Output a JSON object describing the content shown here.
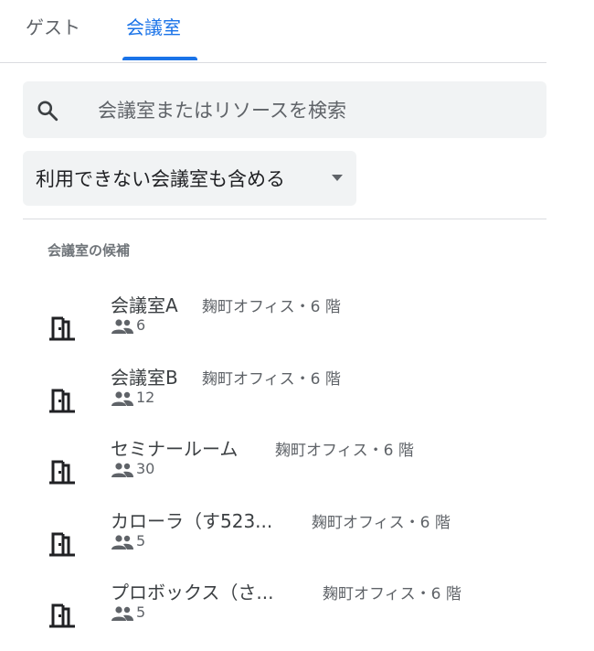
{
  "tabs": [
    {
      "label": "ゲスト",
      "active": false
    },
    {
      "label": "会議室",
      "active": true
    }
  ],
  "search": {
    "placeholder": "会議室またはリソースを検索",
    "value": ""
  },
  "filter": {
    "label": "利用できない会議室も含める"
  },
  "section_title": "会議室の候補",
  "rooms": [
    {
      "name": "会議室A",
      "location": "麹町オフィス・6 階",
      "capacity": "6"
    },
    {
      "name": "会議室B",
      "location": "麹町オフィス・6 階",
      "capacity": "12"
    },
    {
      "name": "セミナールーム",
      "location": "麹町オフィス・6 階",
      "capacity": "30"
    },
    {
      "name": "カローラ（す523...",
      "location": "麹町オフィス・6 階",
      "capacity": "5"
    },
    {
      "name": "プロボックス（さ...",
      "location": "麹町オフィス・6 階",
      "capacity": "5"
    }
  ],
  "colors": {
    "accent": "#1a73e8",
    "surface": "#f1f3f4",
    "text": "#3c4043"
  },
  "icons": {
    "search": "search-icon",
    "dropdown": "caret-down-icon",
    "room": "meeting-room-icon",
    "capacity": "people-icon"
  }
}
